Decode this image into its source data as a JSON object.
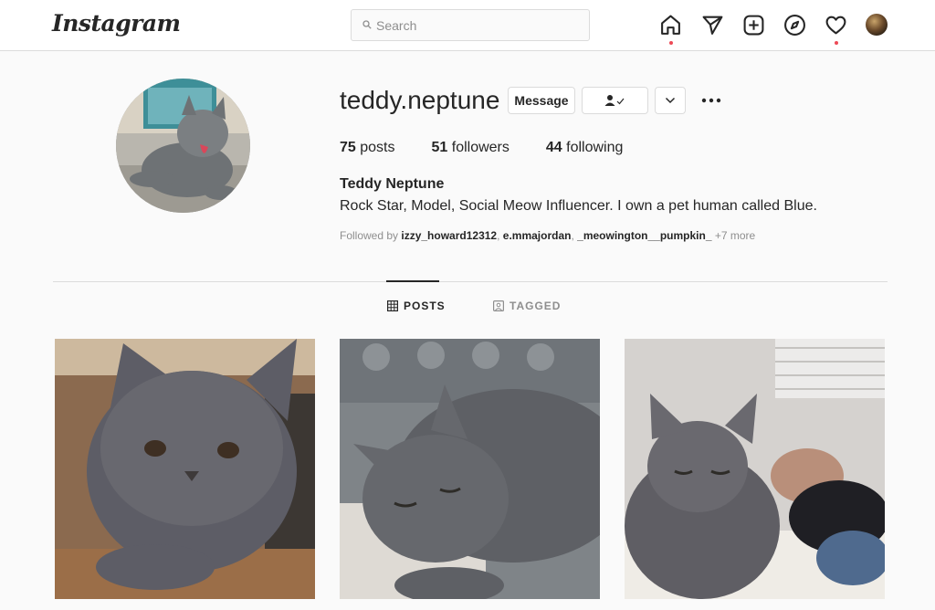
{
  "nav": {
    "logo": "Instagram",
    "search_placeholder": "Search",
    "icons": [
      "home-icon",
      "direct-icon",
      "new-post-icon",
      "explore-icon",
      "activity-heart-icon",
      "profile-avatar"
    ]
  },
  "profile": {
    "username": "teddy.neptune",
    "message_label": "Message",
    "follow_status_icon": "following-check-icon",
    "dropdown_icon": "chevron-down-icon",
    "more_icon": "more-options-icon",
    "stats": {
      "posts_count": "75",
      "posts_label": "posts",
      "followers_count": "51",
      "followers_label": "followers",
      "following_count": "44",
      "following_label": "following"
    },
    "full_name": "Teddy Neptune",
    "bio": "Rock Star, Model, Social Meow Influencer. I own a pet human called Blue.",
    "followed_by": {
      "prefix": "Followed by",
      "users": [
        "izzy_howard12312",
        "e.mmajordan",
        "_meowington__pumpkin_"
      ],
      "more": "+7 more"
    }
  },
  "tabs": [
    {
      "label": "POSTS",
      "icon": "grid-icon",
      "active": true
    },
    {
      "label": "TAGGED",
      "icon": "tagged-icon",
      "active": false
    }
  ],
  "posts": [
    {
      "alt": "cat-photo"
    },
    {
      "alt": "cat-photo"
    },
    {
      "alt": "cat-photo"
    }
  ],
  "colors": {
    "accent_red": "#ed4956",
    "text": "#262626",
    "secondary": "#8e8e8e",
    "border": "#dbdbdb"
  }
}
